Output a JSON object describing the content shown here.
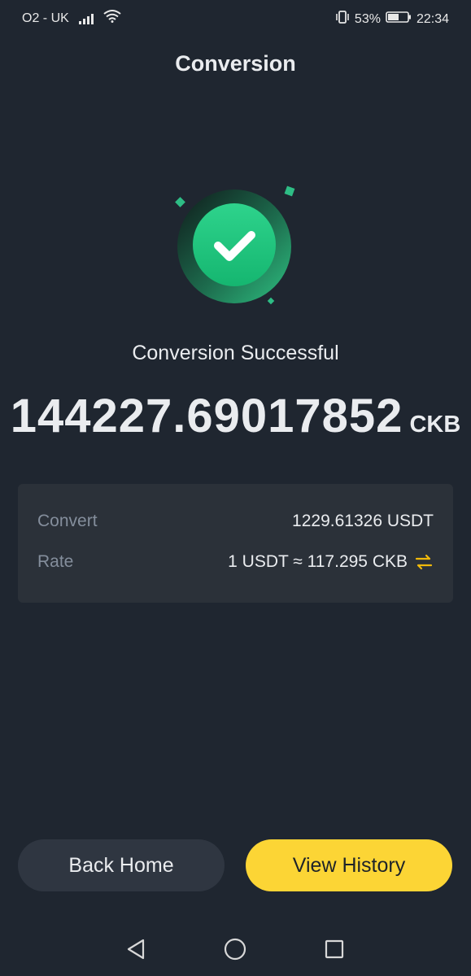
{
  "status_bar": {
    "carrier": "O2 - UK",
    "battery_percent": "53%",
    "time": "22:34"
  },
  "header": {
    "title": "Conversion"
  },
  "result": {
    "message": "Conversion Successful",
    "amount": "144227.69017852",
    "unit": "CKB"
  },
  "details": {
    "convert_label": "Convert",
    "convert_value": "1229.61326 USDT",
    "rate_label": "Rate",
    "rate_value": "1 USDT ≈ 117.295 CKB"
  },
  "buttons": {
    "back_home": "Back Home",
    "view_history": "View History"
  },
  "colors": {
    "background": "#1f2630",
    "card": "#2b3139",
    "accent_yellow": "#fcd535",
    "success_green": "#2ebd85",
    "muted_text": "#848e9c"
  },
  "icons": {
    "success": "checkmark-circle-icon",
    "swap": "swap-arrows-icon",
    "wifi": "wifi-icon",
    "signal": "signal-icon",
    "battery": "battery-icon",
    "vibrate": "vibrate-icon",
    "nav_back": "triangle-back-icon",
    "nav_home": "circle-home-icon",
    "nav_recent": "square-recent-icon"
  }
}
